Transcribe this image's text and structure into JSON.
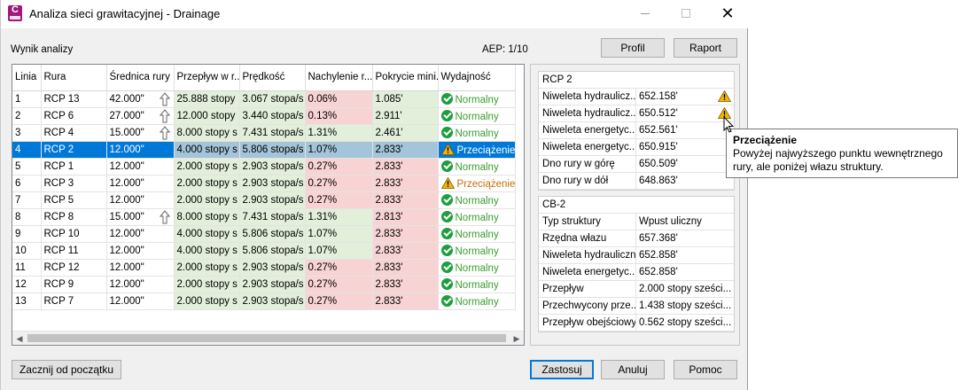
{
  "window": {
    "title": "Analiza sieci grawitacyjnej - Drainage",
    "close_glyph": "✕"
  },
  "header": {
    "results_label": "Wynik analizy",
    "aep": "AEP: 1/10",
    "profile_button": "Profil",
    "report_button": "Raport"
  },
  "table": {
    "columns": [
      "Linia",
      "Rura",
      "Średnica rury",
      "Przepływ w r...",
      "Prędkość",
      "Nachylenie r...",
      "Pokrycie mini...",
      "Wydajność"
    ],
    "rows": [
      {
        "line": "1",
        "pipe": "RCP 13",
        "diameter": "42.000\"",
        "up": true,
        "flow": "25.888 stopy",
        "velocity": "3.067 stopa/s",
        "slope": "0.06%",
        "cover": "1.085'",
        "status": "Normalny",
        "warn": false,
        "slope_red": true,
        "cover_red": false
      },
      {
        "line": "2",
        "pipe": "RCP 6",
        "diameter": "27.000\"",
        "up": true,
        "flow": "12.000 stopy",
        "velocity": "3.440 stopa/s",
        "slope": "0.13%",
        "cover": "2.911'",
        "status": "Normalny",
        "warn": false,
        "slope_red": true,
        "cover_red": false
      },
      {
        "line": "3",
        "pipe": "RCP 4",
        "diameter": "15.000\"",
        "up": true,
        "flow": "8.000 stopy s",
        "velocity": "7.431 stopa/s",
        "slope": "1.31%",
        "cover": "2.461'",
        "status": "Normalny",
        "warn": false,
        "slope_red": false,
        "cover_red": false
      },
      {
        "line": "4",
        "pipe": "RCP 2",
        "diameter": "12.000\"",
        "up": false,
        "flow": "4.000 stopy s",
        "velocity": "5.806 stopa/s",
        "slope": "1.07%",
        "cover": "2.833'",
        "status": "Przeciążenie",
        "warn": true,
        "slope_red": false,
        "cover_red": true
      },
      {
        "line": "5",
        "pipe": "RCP 1",
        "diameter": "12.000\"",
        "up": false,
        "flow": "2.000 stopy s",
        "velocity": "2.903 stopa/s",
        "slope": "0.27%",
        "cover": "2.833'",
        "status": "Normalny",
        "warn": false,
        "slope_red": true,
        "cover_red": true
      },
      {
        "line": "6",
        "pipe": "RCP 3",
        "diameter": "12.000\"",
        "up": false,
        "flow": "2.000 stopy s",
        "velocity": "2.903 stopa/s",
        "slope": "0.27%",
        "cover": "2.833'",
        "status": "Przeciążenie",
        "warn": true,
        "slope_red": true,
        "cover_red": true
      },
      {
        "line": "7",
        "pipe": "RCP 5",
        "diameter": "12.000\"",
        "up": false,
        "flow": "2.000 stopy s",
        "velocity": "2.903 stopa/s",
        "slope": "0.27%",
        "cover": "2.833'",
        "status": "Normalny",
        "warn": false,
        "slope_red": true,
        "cover_red": true
      },
      {
        "line": "8",
        "pipe": "RCP 8",
        "diameter": "15.000\"",
        "up": true,
        "flow": "8.000 stopy s",
        "velocity": "7.431 stopa/s",
        "slope": "1.31%",
        "cover": "2.813'",
        "status": "Normalny",
        "warn": false,
        "slope_red": false,
        "cover_red": true
      },
      {
        "line": "9",
        "pipe": "RCP 10",
        "diameter": "12.000\"",
        "up": false,
        "flow": "4.000 stopy s",
        "velocity": "5.806 stopa/s",
        "slope": "1.07%",
        "cover": "2.833'",
        "status": "Normalny",
        "warn": false,
        "slope_red": false,
        "cover_red": true
      },
      {
        "line": "10",
        "pipe": "RCP 11",
        "diameter": "12.000\"",
        "up": false,
        "flow": "4.000 stopy s",
        "velocity": "5.806 stopa/s",
        "slope": "1.07%",
        "cover": "2.833'",
        "status": "Normalny",
        "warn": false,
        "slope_red": false,
        "cover_red": true
      },
      {
        "line": "11",
        "pipe": "RCP 12",
        "diameter": "12.000\"",
        "up": false,
        "flow": "2.000 stopy s",
        "velocity": "2.903 stopa/s",
        "slope": "0.27%",
        "cover": "2.833'",
        "status": "Normalny",
        "warn": false,
        "slope_red": true,
        "cover_red": true
      },
      {
        "line": "12",
        "pipe": "RCP 9",
        "diameter": "12.000\"",
        "up": false,
        "flow": "2.000 stopy s",
        "velocity": "2.903 stopa/s",
        "slope": "0.27%",
        "cover": "2.833'",
        "status": "Normalny",
        "warn": false,
        "slope_red": true,
        "cover_red": true
      },
      {
        "line": "13",
        "pipe": "RCP 7",
        "diameter": "12.000\"",
        "up": false,
        "flow": "2.000 stopy s",
        "velocity": "2.903 stopa/s",
        "slope": "0.27%",
        "cover": "2.833'",
        "status": "Normalny",
        "warn": false,
        "slope_red": true,
        "cover_red": true
      }
    ],
    "selected_line": "4"
  },
  "pipe_panel": {
    "title": "RCP 2",
    "rows": [
      {
        "key": "Niweleta hydraulicz...",
        "value": "652.158'",
        "warn": true
      },
      {
        "key": "Niweleta hydraulicz...",
        "value": "650.512'",
        "warn": true
      },
      {
        "key": "Niweleta energetyc...",
        "value": "652.561'",
        "warn": false
      },
      {
        "key": "Niweleta energetyc...",
        "value": "650.915'",
        "warn": false
      },
      {
        "key": "Dno rury w górę",
        "value": "650.509'",
        "warn": false
      },
      {
        "key": "Dno rury w dół",
        "value": "648.863'",
        "warn": false
      }
    ]
  },
  "structure_panel": {
    "title": "CB-2",
    "rows": [
      {
        "key": "Typ struktury",
        "value": "Wpust uliczny"
      },
      {
        "key": "Rzędna włazu",
        "value": "657.368'"
      },
      {
        "key": "Niweleta hydrauliczna",
        "value": "652.858'"
      },
      {
        "key": "Niweleta energetyc...",
        "value": "652.858'"
      },
      {
        "key": "Przepływ",
        "value": "2.000 stopy sześci..."
      },
      {
        "key": "Przechwycony prze...",
        "value": "1.438 stopy sześci..."
      },
      {
        "key": "Przepływ obejściowy",
        "value": "0.562 stopy sześci..."
      }
    ]
  },
  "tooltip": {
    "title": "Przeciążenie",
    "line1": "Powyżej najwyższego punktu wewnętrznego",
    "line2": "rury, ale poniżej włazu struktury."
  },
  "footer": {
    "restart_button": "Zacznij od początku",
    "apply_button": "Zastosuj",
    "cancel_button": "Anuluj",
    "help_button": "Pomoc"
  },
  "colors": {
    "selection": "#0078d7",
    "ok_green": "#1e9e3e",
    "warn_orange": "#c5700a",
    "cell_green": "#e2efda",
    "cell_red": "#f8d3d3"
  }
}
